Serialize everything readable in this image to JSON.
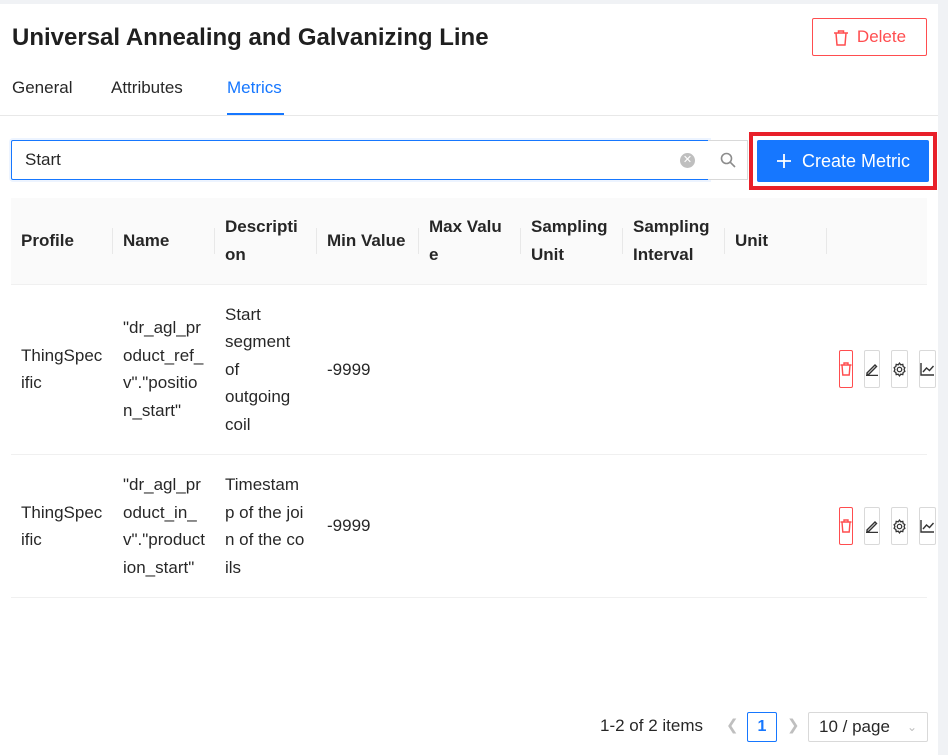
{
  "header": {
    "title": "Universal Annealing and Galvanizing Line",
    "delete_label": "Delete"
  },
  "tabs": [
    {
      "label": "General",
      "active": false
    },
    {
      "label": "Attributes",
      "active": false
    },
    {
      "label": "Metrics",
      "active": true
    }
  ],
  "search": {
    "value": "Start",
    "placeholder": ""
  },
  "toolbar": {
    "create_label": "Create Metric"
  },
  "table": {
    "columns": [
      "Profile",
      "Name",
      "Description",
      "Min Value",
      "Max Value",
      "Sampling Unit",
      "Sampling Interval",
      "Unit",
      ""
    ],
    "rows": [
      {
        "profile": "ThingSpecific",
        "name": "\"dr_agl_product_ref_v\".\"position_start\"",
        "description": "Start segment of outgoing coil",
        "min_value": "-9999",
        "max_value": "",
        "sampling_unit": "",
        "sampling_interval": "",
        "unit": ""
      },
      {
        "profile": "ThingSpecific",
        "name": "\"dr_agl_product_in_v\".\"production_start\"",
        "description": "Timestamp of the join of the coils",
        "min_value": "-9999",
        "max_value": "",
        "sampling_unit": "",
        "sampling_interval": "",
        "unit": ""
      }
    ]
  },
  "pagination": {
    "total_text": "1-2 of 2 items",
    "current_page": "1",
    "page_size": "10 / page"
  },
  "icons": {
    "delete": "trash-icon",
    "clear": "close-circle-icon",
    "search": "search-icon",
    "create": "plus-icon",
    "edit": "pencil-icon",
    "settings": "gear-icon",
    "chart": "line-chart-icon",
    "prev": "chevron-left-icon",
    "next": "chevron-right-icon",
    "dropdown": "chevron-down-icon"
  },
  "colors": {
    "primary": "#1677ff",
    "danger": "#ff4d4f",
    "highlight": "#e8202a"
  }
}
